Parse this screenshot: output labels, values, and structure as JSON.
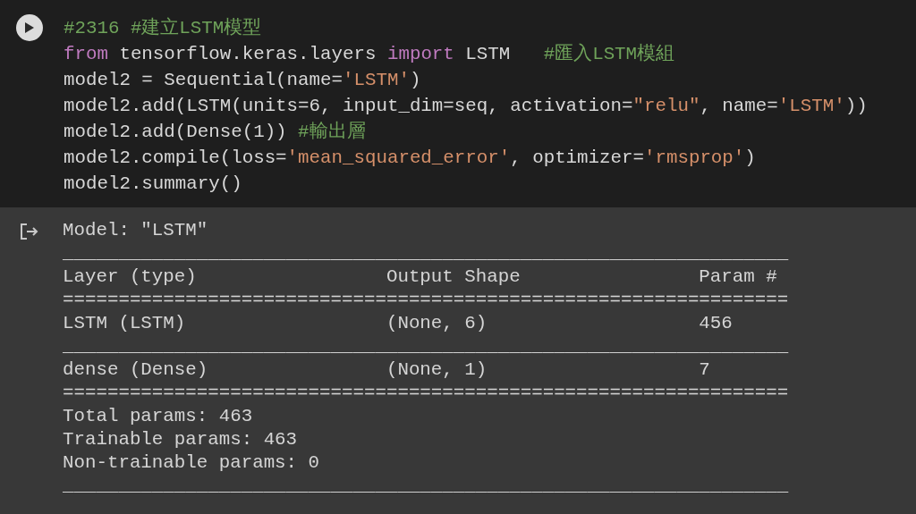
{
  "code_cell": {
    "lines": [
      [
        {
          "kind": "comment",
          "text": "#2316 #建立LSTM模型"
        }
      ],
      [
        {
          "kind": "keyword",
          "text": "from"
        },
        {
          "kind": "plain",
          "text": " tensorflow.keras.layers "
        },
        {
          "kind": "keyword",
          "text": "import"
        },
        {
          "kind": "plain",
          "text": " LSTM   "
        },
        {
          "kind": "comment",
          "text": "#匯入LSTM模組"
        }
      ],
      [
        {
          "kind": "plain",
          "text": "model2 = Sequential(name="
        },
        {
          "kind": "string",
          "text": "'LSTM'"
        },
        {
          "kind": "plain",
          "text": ")"
        }
      ],
      [
        {
          "kind": "plain",
          "text": "model2.add(LSTM(units=6, input_dim=seq, activation="
        },
        {
          "kind": "string",
          "text": "\"relu\""
        },
        {
          "kind": "plain",
          "text": ", name="
        },
        {
          "kind": "string",
          "text": "'LSTM'"
        },
        {
          "kind": "plain",
          "text": "))"
        }
      ],
      [
        {
          "kind": "plain",
          "text": "model2.add(Dense(1)) "
        },
        {
          "kind": "comment",
          "text": "#輸出層"
        }
      ],
      [
        {
          "kind": "plain",
          "text": "model2.compile(loss="
        },
        {
          "kind": "string",
          "text": "'mean_squared_error'"
        },
        {
          "kind": "plain",
          "text": ", optimizer="
        },
        {
          "kind": "string",
          "text": "'rmsprop'"
        },
        {
          "kind": "plain",
          "text": ")"
        }
      ],
      [
        {
          "kind": "plain",
          "text": "model2.summary()"
        }
      ]
    ]
  },
  "output": {
    "lines": [
      "Model: \"LSTM\"",
      "_________________________________________________________________",
      "Layer (type)                 Output Shape                Param #",
      "=================================================================",
      "LSTM (LSTM)                  (None, 6)                   456",
      "_________________________________________________________________",
      "dense (Dense)                (None, 1)                   7",
      "=================================================================",
      "Total params: 463",
      "Trainable params: 463",
      "Non-trainable params: 0",
      "_________________________________________________________________"
    ]
  }
}
